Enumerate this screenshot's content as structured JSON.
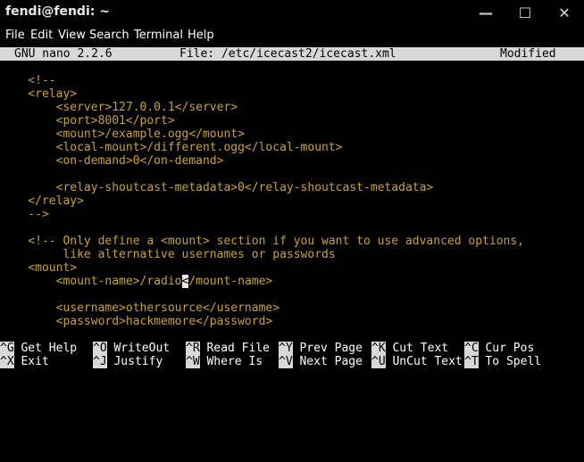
{
  "window": {
    "title": "fendi@fendi: ~",
    "min": "—",
    "max": "☐",
    "close": "✕"
  },
  "menu": [
    "File",
    "Edit",
    "View",
    "Search",
    "Terminal",
    "Help"
  ],
  "nano": {
    "version": "GNU nano 2.2.6",
    "file": "File: /etc/icecast2/icecast.xml",
    "state": "Modified"
  },
  "lines": [
    "    <!--",
    "    <relay>",
    "        <server>127.0.0.1</server>",
    "        <port>8001</port>",
    "        <mount>/example.ogg</mount>",
    "        <local-mount>/different.ogg</local-mount>",
    "        <on-demand>0</on-demand>",
    "",
    "        <relay-shoutcast-metadata>0</relay-shoutcast-metadata>",
    "    </relay>",
    "    -->",
    "",
    "    <!-- Only define a <mount> section if you want to use advanced options,",
    "         like alternative usernames or passwords",
    "    <mount>",
    "",
    "",
    "        <username>othersource</username>",
    "        <password>hackmemore</password>"
  ],
  "cursor_line": {
    "before": "        <mount-name>/radio",
    "cursor_char": "<",
    "after": "/mount-name>"
  },
  "shortcuts_row1": [
    {
      "key": "^G",
      "label": "Get Help"
    },
    {
      "key": "^O",
      "label": "WriteOut"
    },
    {
      "key": "^R",
      "label": "Read File"
    },
    {
      "key": "^Y",
      "label": "Prev Page"
    },
    {
      "key": "^K",
      "label": "Cut Text"
    },
    {
      "key": "^C",
      "label": "Cur Pos"
    }
  ],
  "shortcuts_row2": [
    {
      "key": "^X",
      "label": "Exit"
    },
    {
      "key": "^J",
      "label": "Justify"
    },
    {
      "key": "^W",
      "label": "Where Is"
    },
    {
      "key": "^V",
      "label": "Next Page"
    },
    {
      "key": "^U",
      "label": "UnCut Text"
    },
    {
      "key": "^T",
      "label": "To Spell"
    }
  ],
  "colors": {
    "text": "#c8a23a",
    "background": "#000000",
    "bar": "#d8d8d8"
  }
}
